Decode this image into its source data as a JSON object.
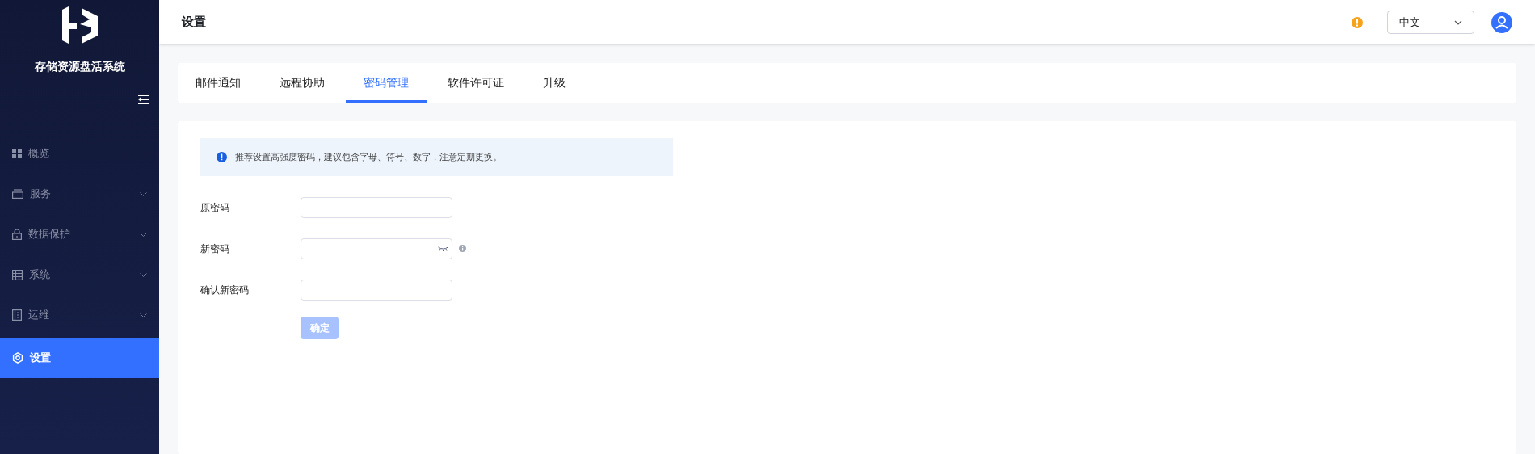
{
  "app": {
    "title": "存储资源盘活系统"
  },
  "sidebar": {
    "items": [
      {
        "label": "概览",
        "selected": false,
        "expandable": false
      },
      {
        "label": "服务",
        "selected": false,
        "expandable": true
      },
      {
        "label": "数据保护",
        "selected": false,
        "expandable": true
      },
      {
        "label": "系统",
        "selected": false,
        "expandable": true
      },
      {
        "label": "运维",
        "selected": false,
        "expandable": true
      },
      {
        "label": "设置",
        "selected": true,
        "expandable": false
      }
    ]
  },
  "header": {
    "title": "设置",
    "language": "中文"
  },
  "tabs": [
    {
      "label": "邮件通知",
      "selected": false
    },
    {
      "label": "远程协助",
      "selected": false
    },
    {
      "label": "密码管理",
      "selected": true
    },
    {
      "label": "软件许可证",
      "selected": false
    },
    {
      "label": "升级",
      "selected": false
    }
  ],
  "alert": {
    "text": "推荐设置高强度密码，建议包含字母、符号、数字，注意定期更换。"
  },
  "form": {
    "fields": [
      {
        "label": "原密码",
        "kind": "plain"
      },
      {
        "label": "新密码",
        "kind": "reveal"
      },
      {
        "label": "确认新密码",
        "kind": "plain"
      }
    ],
    "submit": {
      "label": "确定",
      "disabled": true
    }
  }
}
